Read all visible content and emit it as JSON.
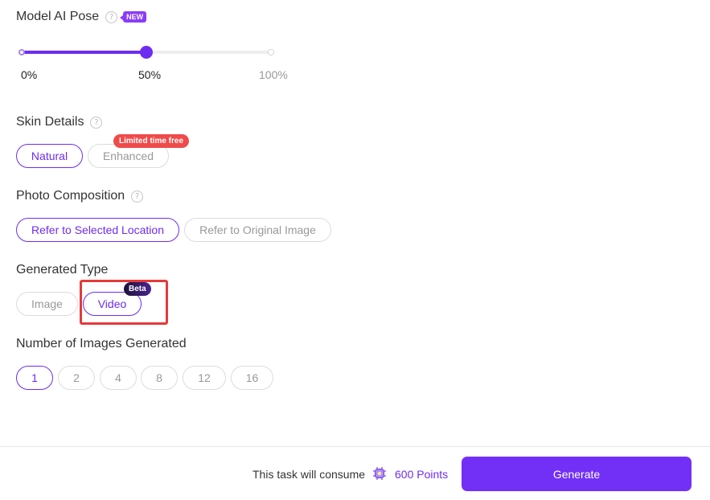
{
  "pose": {
    "title": "Model AI Pose",
    "help_icon": "?",
    "new_badge": "NEW",
    "value": 0.5,
    "labels": {
      "min": "0%",
      "mid": "50%",
      "max": "100%"
    }
  },
  "skin": {
    "title": "Skin Details",
    "help_icon": "?",
    "options": [
      {
        "label": "Natural",
        "selected": true
      },
      {
        "label": "Enhanced",
        "selected": false
      }
    ],
    "promo_tag": "Limited time free"
  },
  "composition": {
    "title": "Photo Composition",
    "help_icon": "?",
    "options": [
      {
        "label": "Refer to Selected Location",
        "selected": true
      },
      {
        "label": "Refer to Original Image",
        "selected": false
      }
    ]
  },
  "generated_type": {
    "title": "Generated Type",
    "options": [
      {
        "label": "Image",
        "selected": false
      },
      {
        "label": "Video",
        "selected": true
      }
    ],
    "beta_tag": "Beta"
  },
  "count": {
    "title": "Number of Images Generated",
    "options": [
      "1",
      "2",
      "4",
      "8",
      "12",
      "16"
    ],
    "selected": "1"
  },
  "footer": {
    "consume_text": "This task will consume",
    "points_icon": "chip-icon",
    "points": "600 Points",
    "generate_label": "Generate"
  },
  "colors": {
    "accent": "#7230f7",
    "badge_red": "#f04a4a",
    "highlight": "#e53a3a"
  }
}
